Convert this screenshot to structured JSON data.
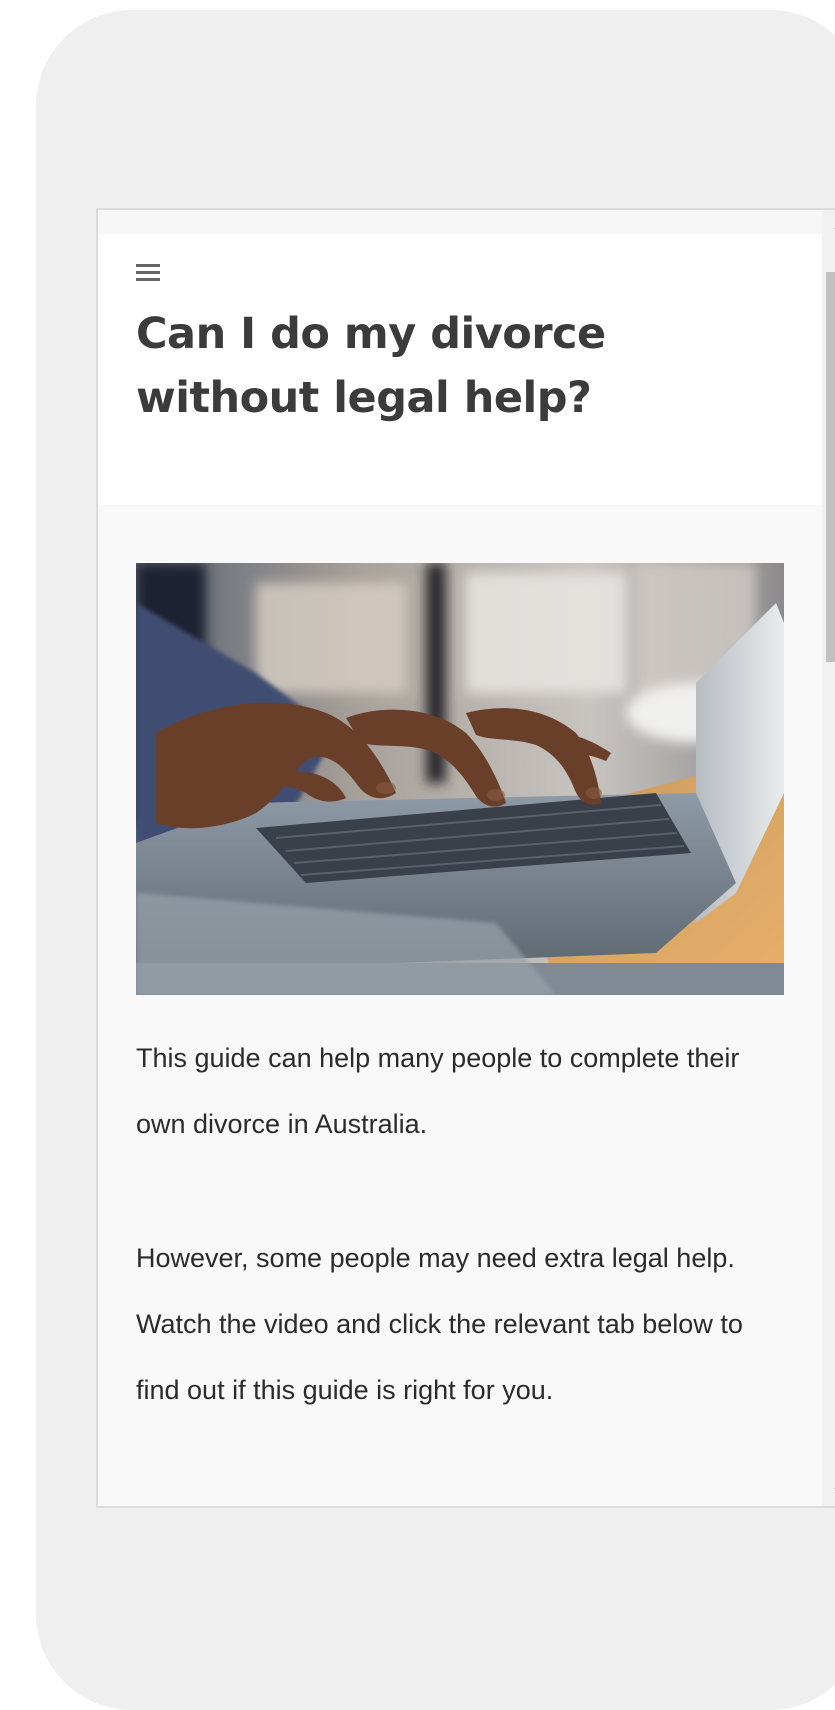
{
  "header": {
    "menu_icon": "hamburger-menu-icon",
    "title": "Can I do my divorce without legal help?"
  },
  "hero_image": {
    "description_icon": "laptop-typing-photo"
  },
  "body": {
    "paragraph_1": "This guide can help many people to complete their own divorce in Australia.",
    "paragraph_2": "However, some people may need extra legal help. Watch the video and click the relevant tab below to find out if this guide is right for you."
  },
  "colors": {
    "phone_frame": "#efefef",
    "title": "#3b3b3b",
    "text": "#2b2b2b",
    "content_bg": "#f9f9f9",
    "scroll_thumb": "#c1c1c1"
  }
}
